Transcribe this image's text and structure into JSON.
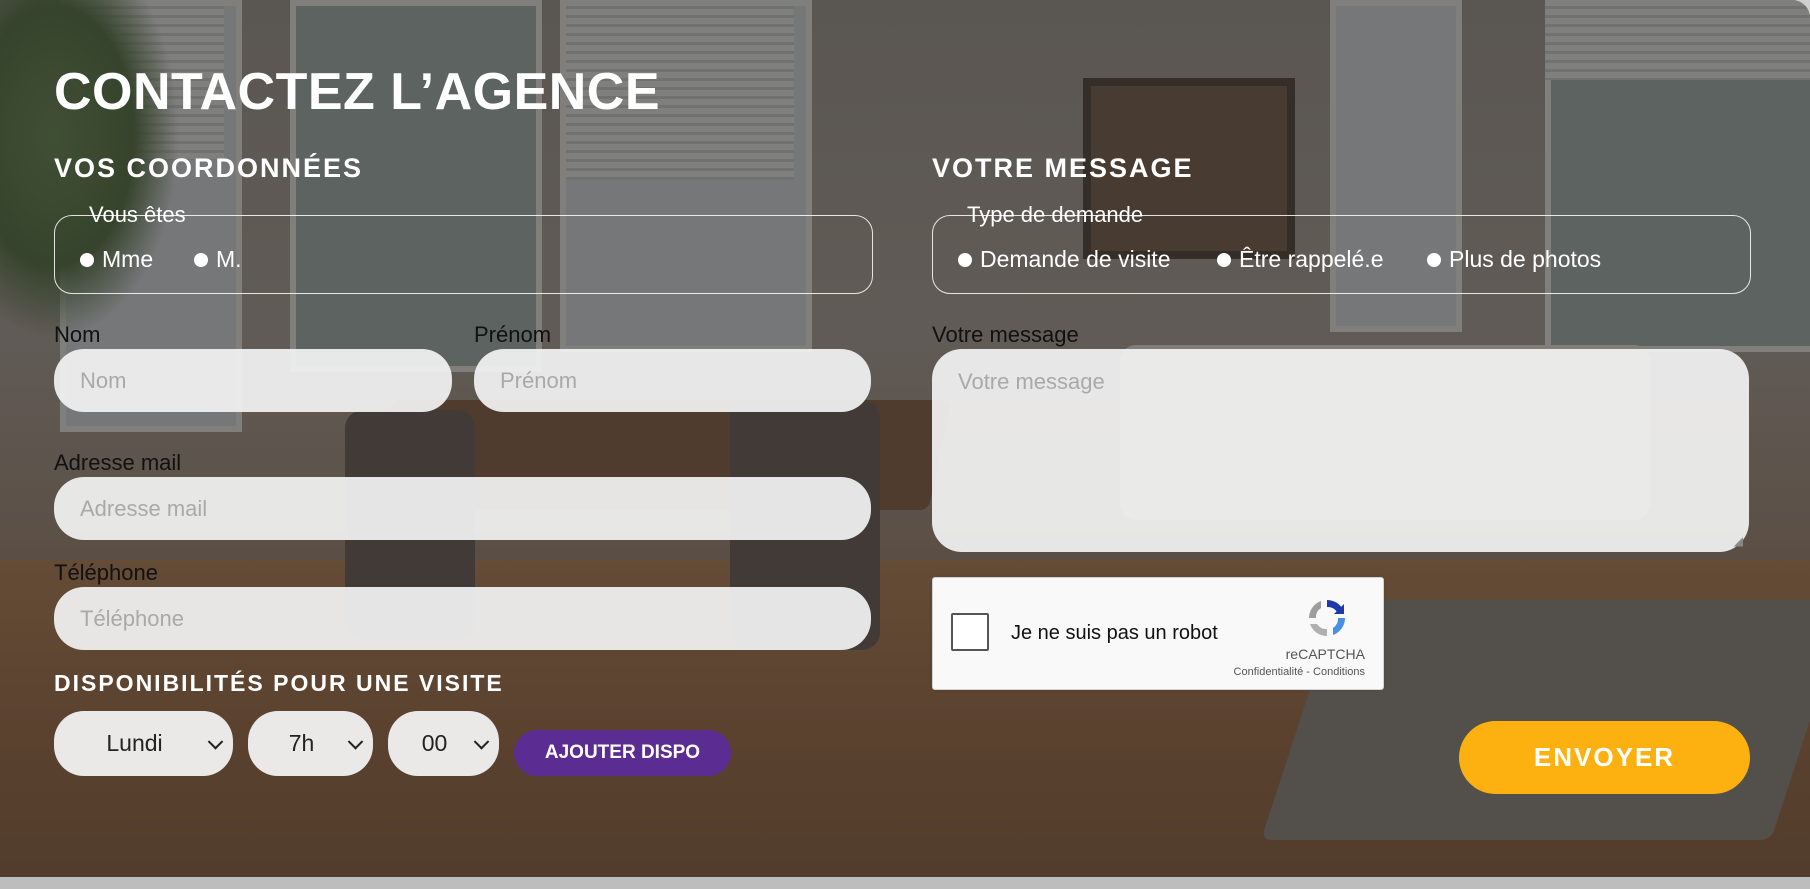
{
  "title": "CONTACTEZ L’AGENCE",
  "coordonnees": {
    "heading": "VOS COORDONNÉES",
    "civility": {
      "legend": "Vous êtes",
      "options": [
        "Mme",
        "M."
      ]
    },
    "nom": {
      "label": "Nom",
      "placeholder": "Nom"
    },
    "prenom": {
      "label": "Prénom",
      "placeholder": "Prénom"
    },
    "email": {
      "label": "Adresse mail",
      "placeholder": "Adresse mail"
    },
    "phone": {
      "label": "Téléphone",
      "placeholder": "Téléphone"
    }
  },
  "disponibilites": {
    "heading": "DISPONIBILITÉS POUR UNE VISITE",
    "day": "Lundi",
    "hour": "7h",
    "minute": "00",
    "add_label": "AJOUTER DISPO"
  },
  "message": {
    "heading": "VOTRE MESSAGE",
    "request": {
      "legend": "Type de demande",
      "options": [
        "Demande de visite",
        "Être rappelé.e",
        "Plus de photos"
      ]
    },
    "label": "Votre message",
    "placeholder": "Votre message"
  },
  "captcha": {
    "text": "Je ne suis pas un robot",
    "brand": "reCAPTCHA",
    "links": "Confidentialité - Conditions"
  },
  "submit_label": "ENVOYER",
  "colors": {
    "accent": "#fdb111",
    "purple": "#5b2c92"
  }
}
